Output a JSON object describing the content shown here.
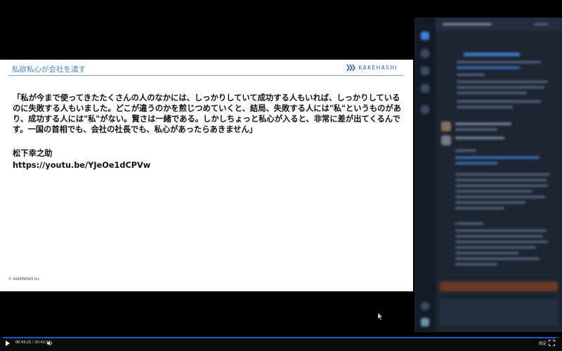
{
  "slide": {
    "title": "私欲私心が会社を潰す",
    "logo_text": "KAKEHASHI",
    "quote": "「私が今まで使ってきたたくさんの人のなかには、しっかりしていて成功する人もいれば、しっかりしているのに失敗する人もいました。どこが違うのかを煎じつめていくと、結局、失敗する人には\"私\"というものがあり、成功する人には\"私\"がない。賢さは一緒である。しかしちょっと私心が入ると、非常に差が出てくるんです。一国の首相でも、会社の社長でも、私心があったらあきません」",
    "author": "松下幸之助",
    "url": "https://youtu.be/YJeOe1dCPVw",
    "copyright": "© KAKEHASHI Inc."
  },
  "player": {
    "current_time": "00:43:21",
    "separator": " / ",
    "total_time": "00:43:33",
    "settings_label": "設定",
    "progress": 0.995
  },
  "colors": {
    "title": "#4a82c2",
    "logo": "#2c5f9e",
    "progress": "#1a56c8",
    "chat_bg": "#1d2533"
  },
  "icons": {
    "play": "play-icon",
    "volume": "volume-icon",
    "fullscreen": "fullscreen-icon",
    "logo": "kakehashi-logo-icon"
  }
}
